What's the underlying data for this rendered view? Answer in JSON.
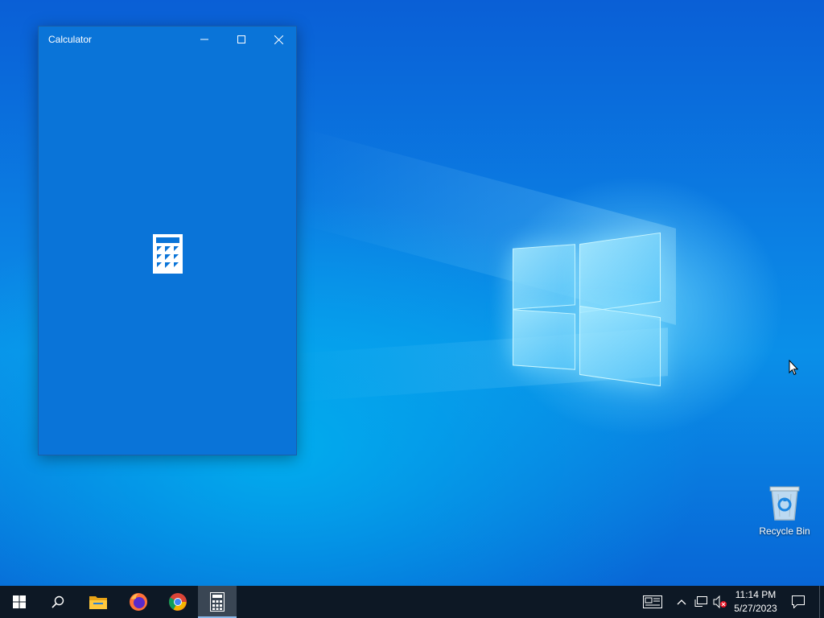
{
  "window": {
    "title": "Calculator",
    "minimize_icon": "minimize-icon",
    "maximize_icon": "maximize-icon",
    "close_icon": "close-icon",
    "splash_icon": "calculator-icon",
    "background_color": "#0a74d8"
  },
  "desktop": {
    "icons": [
      {
        "label": "Recycle Bin",
        "icon": "recycle-bin-icon"
      }
    ]
  },
  "taskbar": {
    "background_color": "#0d1825",
    "buttons": [
      {
        "name": "start",
        "icon": "windows-start-icon"
      },
      {
        "name": "search",
        "icon": "search-icon"
      },
      {
        "name": "file-explorer",
        "icon": "folder-icon"
      },
      {
        "name": "firefox",
        "icon": "firefox-icon"
      },
      {
        "name": "chrome",
        "icon": "chrome-icon"
      },
      {
        "name": "calculator",
        "icon": "calculator-icon",
        "active": true
      }
    ],
    "tray": {
      "icons": [
        "news-icon",
        "chevron-up-icon",
        "network-icon",
        "volume-muted-icon"
      ],
      "time": "11:14 PM",
      "date": "5/27/2023",
      "notification_icon": "notification-icon"
    }
  }
}
